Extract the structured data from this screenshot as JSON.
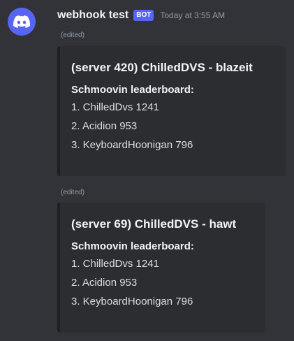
{
  "message": {
    "username": "webhook test",
    "bot_tag": "BOT",
    "timestamp": "Today at 3:55 AM",
    "avatar_icon": "discord-logo-icon",
    "avatar_color": "#5865f2"
  },
  "embeds": [
    {
      "edited_label": "(edited)",
      "title": "(server 420) ChilledDVS - blazeit",
      "subtitle": "Schmoovin leaderboard:",
      "lines": [
        "1. ChilledDvs 1241",
        "2. Acidion 953",
        "3. KeyboardHoonigan 796"
      ]
    },
    {
      "edited_label": "(edited)",
      "title": "(server 69) ChilledDVS - hawt",
      "subtitle": "Schmoovin leaderboard:",
      "lines": [
        "1. ChilledDvs 1241",
        "2. Acidion 953",
        "3. KeyboardHoonigan 796"
      ]
    }
  ]
}
